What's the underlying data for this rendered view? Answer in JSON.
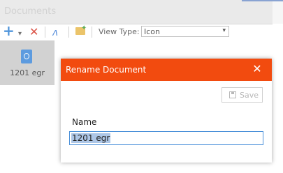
{
  "panel": {
    "title": "Documents"
  },
  "toolbar": {
    "add_icon": "+",
    "caret_icon": "▾",
    "delete_icon": "✕",
    "sign_icon": "ʌ",
    "view_type_label": "View Type:",
    "view_type_value": "Icon",
    "view_type_arrow": "▾"
  },
  "tile": {
    "label": "1201 egr"
  },
  "dialog": {
    "title": "Rename Document",
    "close_icon": "✕",
    "save_label": "Save",
    "name_label": "Name",
    "name_value": "1201 egr"
  },
  "colors": {
    "title_bar": "#f24b0f",
    "input_border": "#4a90d9",
    "selection": "#adc6e6"
  }
}
